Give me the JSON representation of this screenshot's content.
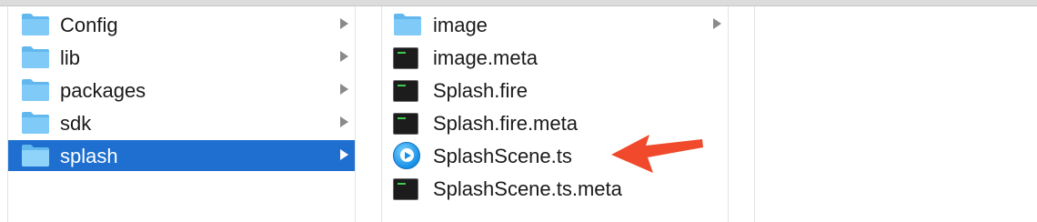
{
  "column1": {
    "items": [
      {
        "label": "Config",
        "icon": "folder-icon",
        "has_children": true,
        "selected": false
      },
      {
        "label": "lib",
        "icon": "folder-icon",
        "has_children": true,
        "selected": false
      },
      {
        "label": "packages",
        "icon": "folder-icon",
        "has_children": true,
        "selected": false
      },
      {
        "label": "sdk",
        "icon": "folder-icon",
        "has_children": true,
        "selected": false
      },
      {
        "label": "splash",
        "icon": "folder-icon",
        "has_children": true,
        "selected": true
      }
    ]
  },
  "column2": {
    "items": [
      {
        "label": "image",
        "icon": "folder-icon",
        "has_children": true
      },
      {
        "label": "image.meta",
        "icon": "terminal-file-icon",
        "has_children": false
      },
      {
        "label": "Splash.fire",
        "icon": "terminal-file-icon",
        "has_children": false
      },
      {
        "label": "Splash.fire.meta",
        "icon": "terminal-file-icon",
        "has_children": false
      },
      {
        "label": "SplashScene.ts",
        "icon": "typescript-file-icon",
        "has_children": false
      },
      {
        "label": "SplashScene.ts.meta",
        "icon": "terminal-file-icon",
        "has_children": false
      }
    ]
  },
  "annotation": {
    "icon": "red-arrow-icon",
    "color": "#f0492c"
  },
  "colors": {
    "selection": "#1f6fd0",
    "folder": "#62b8ee"
  }
}
